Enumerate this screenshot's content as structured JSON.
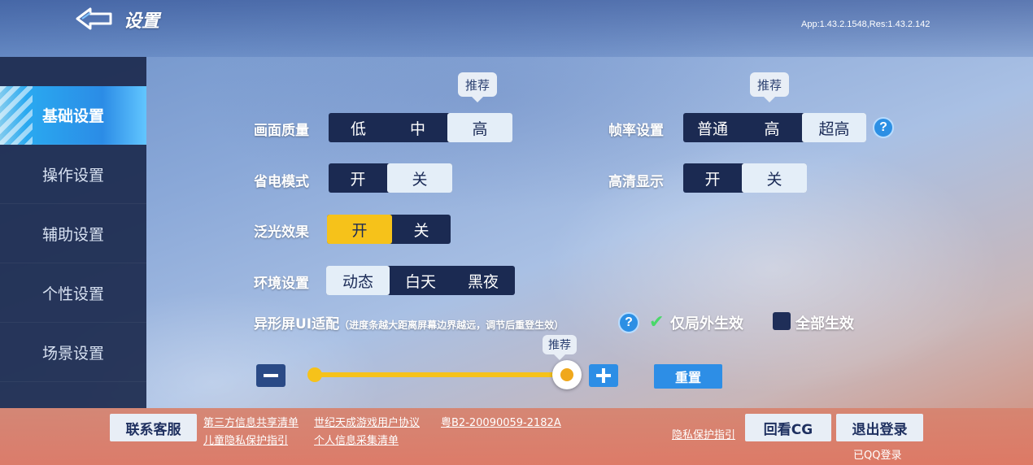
{
  "header": {
    "title": "设置",
    "version": "App:1.43.2.1548,Res:1.43.2.142"
  },
  "sidebar": {
    "items": [
      {
        "label": "基础设置",
        "active": true
      },
      {
        "label": "操作设置"
      },
      {
        "label": "辅助设置"
      },
      {
        "label": "个性设置"
      },
      {
        "label": "场景设置"
      }
    ]
  },
  "settings": {
    "quality": {
      "label": "画面质量",
      "options": [
        "低",
        "中",
        "高"
      ],
      "selected": "高",
      "tip": "推荐"
    },
    "framerate": {
      "label": "帧率设置",
      "options": [
        "普通",
        "高",
        "超高"
      ],
      "selected": "超高",
      "tip": "推荐",
      "help": "?"
    },
    "power_saving": {
      "label": "省电模式",
      "options": [
        "开",
        "关"
      ],
      "selected": "关"
    },
    "hd_display": {
      "label": "高清显示",
      "options": [
        "开",
        "关"
      ],
      "selected": "关"
    },
    "bloom": {
      "label": "泛光效果",
      "options": [
        "开",
        "关"
      ],
      "selected": "开"
    },
    "environment": {
      "label": "环境设置",
      "options": [
        "动态",
        "白天",
        "黑夜"
      ],
      "selected": "动态"
    },
    "screen_adapt": {
      "label": "异形屏UI适配",
      "note": "（进度条越大距离屏幕边界越远，调节后重登生效）",
      "help": "?",
      "check_mark": "✔",
      "option_ingame": "仅局外生效",
      "option_all": "全部生效",
      "ingame_checked": true,
      "all_checked": false,
      "slider_tip": "推荐",
      "slider_level": 1.0,
      "reset_label": "重置"
    }
  },
  "footer": {
    "support_button": "联系客服",
    "links": {
      "third_party": "第三方信息共享清单",
      "user_agreement": "世纪天成游戏用户协议",
      "license": "粤B2-20090059-2182A",
      "child_privacy": "儿童隐私保护指引",
      "personal_info": "个人信息采集清单",
      "privacy": "隐私保护指引"
    },
    "replay_cg_button": "回看CG",
    "logout_button": "退出登录",
    "login_status": "已QQ登录"
  },
  "colors": {
    "accent_blue": "#2d8ee6",
    "selected_yellow": "#f6c21a",
    "segment_dark": "#1b2a52",
    "check_green": "#4ad86a"
  }
}
